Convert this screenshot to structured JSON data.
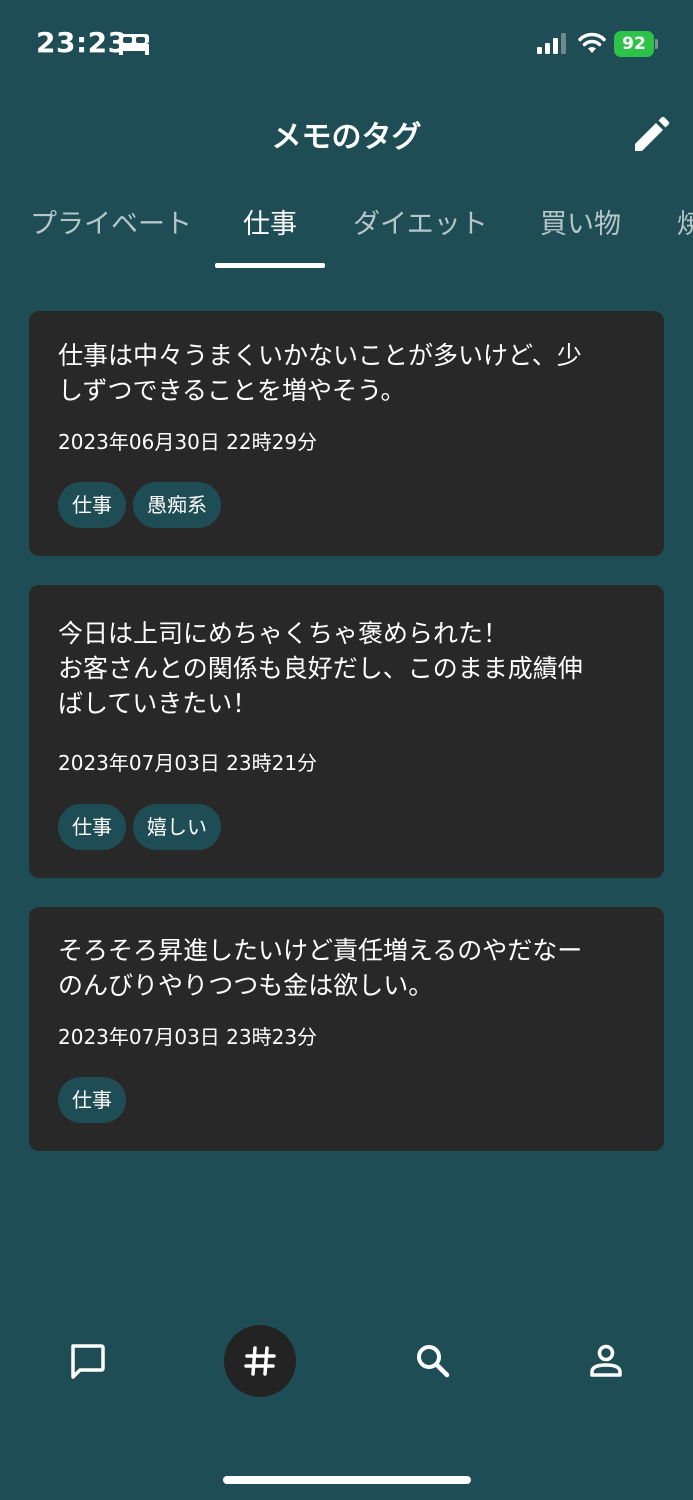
{
  "status_bar": {
    "time": "23:23",
    "battery": "92"
  },
  "header": {
    "title": "メモのタグ"
  },
  "tabs": [
    {
      "label": "プライベート"
    },
    {
      "label": "仕事"
    },
    {
      "label": "ダイエット"
    },
    {
      "label": "買い物"
    },
    {
      "label": "焼"
    }
  ],
  "active_tab": "仕事",
  "memos": [
    {
      "text": "仕事は中々うまくいかないことが多いけど、少\nしずつできることを増やそう。",
      "date": "2023年06月30日 22時29分",
      "tags": [
        "仕事",
        "愚痴系"
      ]
    },
    {
      "text": "今日は上司にめちゃくちゃ褒められた！\nお客さんとの関係も良好だし、このまま成績伸\nばしていきたい！",
      "date": "2023年07月03日 23時21分",
      "tags": [
        "仕事",
        "嬉しい"
      ]
    },
    {
      "text": "そろそろ昇進したいけど責任増えるのやだなー\nのんびりやりつつも金は欲しい。",
      "date": "2023年07月03日 23時23分",
      "tags": [
        "仕事"
      ]
    }
  ],
  "bottom_nav": [
    {
      "icon": "chat-icon"
    },
    {
      "icon": "hashtag-icon",
      "active": true
    },
    {
      "icon": "search-icon"
    },
    {
      "icon": "profile-icon"
    }
  ],
  "colors": {
    "background": "#1f4d55",
    "card": "#282828",
    "chip": "#1f4d55",
    "battery": "#2ec24a"
  }
}
